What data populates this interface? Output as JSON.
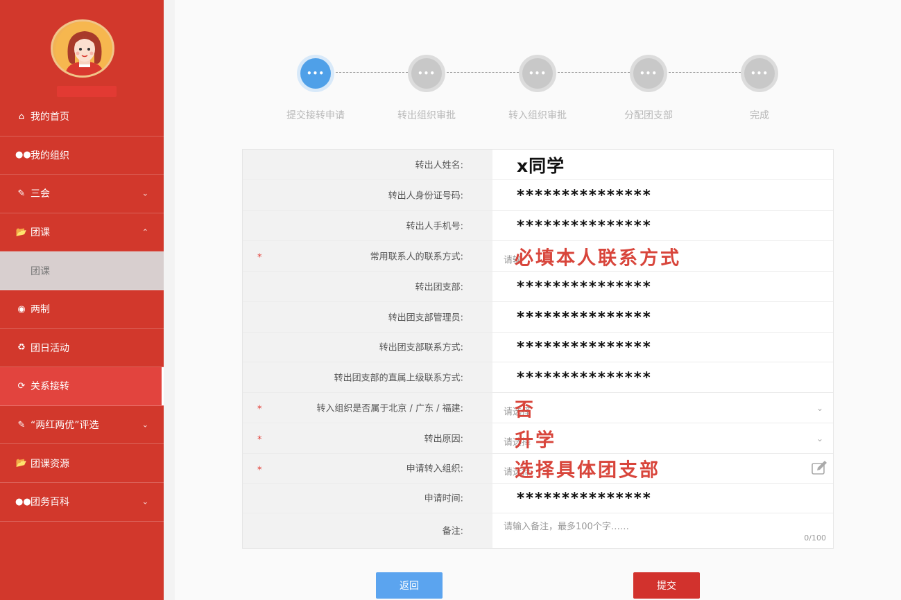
{
  "sidebar": {
    "items": [
      {
        "label": "我的首页",
        "icon": "home-icon"
      },
      {
        "label": "我的组织",
        "icon": "users-icon"
      },
      {
        "label": "三会",
        "icon": "edit-icon",
        "chevron": "down"
      },
      {
        "label": "团课",
        "icon": "folder-open-icon",
        "chevron": "up"
      },
      {
        "label": "团课",
        "sub": true
      },
      {
        "label": "两制",
        "icon": "target-icon"
      },
      {
        "label": "团日活动",
        "icon": "recycle-icon"
      },
      {
        "label": "关系接转",
        "icon": "refresh-icon",
        "active": true
      },
      {
        "label": "“两红两优”评选",
        "icon": "edit-icon",
        "chevron": "down"
      },
      {
        "label": "团课资源",
        "icon": "folder-open-icon"
      },
      {
        "label": "团务百科",
        "icon": "users-icon",
        "chevron": "down"
      }
    ]
  },
  "steps": [
    {
      "label": "提交接转申请",
      "active": true,
      "dots": "•••"
    },
    {
      "label": "转出组织审批",
      "dots": "•••"
    },
    {
      "label": "转入组织审批",
      "dots": "•••"
    },
    {
      "label": "分配团支部",
      "dots": "•••"
    },
    {
      "label": "完成",
      "dots": "•••"
    }
  ],
  "form": {
    "rows": [
      {
        "label": "转出人姓名:",
        "value": "x同学"
      },
      {
        "label": "转出人身份证号码:",
        "value": "***************"
      },
      {
        "label": "转出人手机号:",
        "value": "***************"
      },
      {
        "label": "常用联系人的联系方式:",
        "required": "*",
        "placeholder": "请输",
        "annotation": "必填本人联系方式"
      },
      {
        "label": "转出团支部:",
        "value": "***************"
      },
      {
        "label": "转出团支部管理员:",
        "value": "***************"
      },
      {
        "label": "转出团支部联系方式:",
        "value": "***************"
      },
      {
        "label": "转出团支部的直属上级联系方式:",
        "value": "***************"
      },
      {
        "label": "转入组织是否属于北京 / 广东 / 福建:",
        "required": "*",
        "placeholder": "请选择",
        "annotation": "否"
      },
      {
        "label": "转出原因:",
        "required": "*",
        "placeholder": "请选择",
        "annotation": "升学"
      },
      {
        "label": "申请转入组织:",
        "required": "*",
        "placeholder": "请选择",
        "annotation": "选择具体团支部"
      },
      {
        "label": "申请时间:",
        "value": "***************"
      },
      {
        "label": "备注:",
        "placeholder": "请输入备注，最多100个字……",
        "counter": "0/100"
      }
    ]
  },
  "buttons": {
    "back": "返回",
    "submit": "提交"
  },
  "colors": {
    "sidebar": "#d2382c",
    "accent_blue": "#4fa0e8",
    "submit_red": "#d2322d",
    "annotation_red": "#d8453b"
  }
}
